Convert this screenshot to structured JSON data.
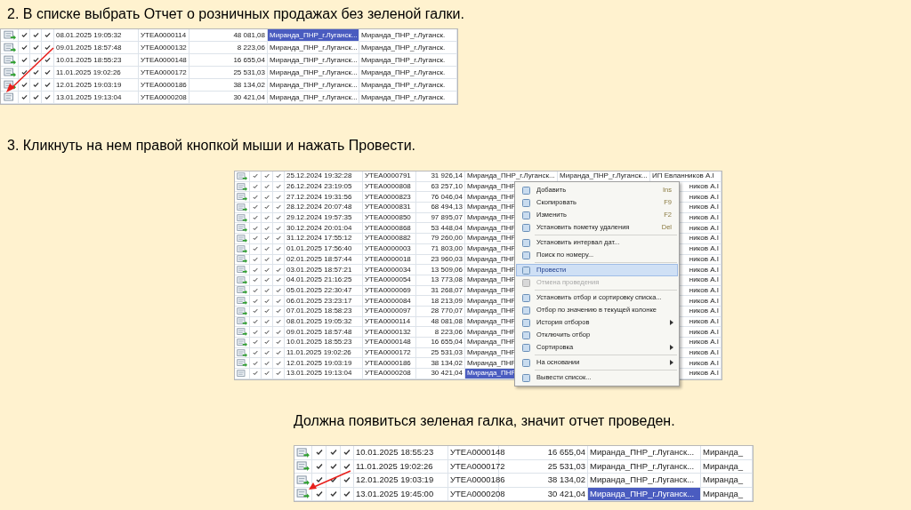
{
  "step_2": {
    "instruction": "2. В списке выбрать Отчет о розничных продажах без зеленой галки.",
    "table": {
      "rows": [
        {
          "posted": true,
          "marks": [
            true,
            true,
            true
          ],
          "date": "08.01.2025 19:05:32",
          "number": "УТЕА0000114",
          "sum": "48 081,08",
          "cells": [
            "Миранда_ПНР_г.Луганск...",
            "Миранда_ПНР_г.Луганск."
          ],
          "selected": true
        },
        {
          "posted": true,
          "marks": [
            true,
            true,
            true
          ],
          "date": "09.01.2025 18:57:48",
          "number": "УТЕА0000132",
          "sum": "8 223,06",
          "cells": [
            "Миранда_ПНР_г.Луганск...",
            "Миранда_ПНР_г.Луганск."
          ],
          "selected": false
        },
        {
          "posted": true,
          "marks": [
            true,
            true,
            true
          ],
          "date": "10.01.2025 18:55:23",
          "number": "УТЕА0000148",
          "sum": "16 655,04",
          "cells": [
            "Миранда_ПНР_г.Луганск...",
            "Миранда_ПНР_г.Луганск."
          ],
          "selected": false
        },
        {
          "posted": true,
          "marks": [
            true,
            true,
            true
          ],
          "date": "11.01.2025 19:02:26",
          "number": "УТЕА0000172",
          "sum": "25 531,03",
          "cells": [
            "Миранда_ПНР_г.Луганск...",
            "Миранда_ПНР_г.Луганск."
          ],
          "selected": false
        },
        {
          "posted": true,
          "marks": [
            true,
            true,
            true
          ],
          "date": "12.01.2025 19:03:19",
          "number": "УТЕА0000186",
          "sum": "38 134,02",
          "cells": [
            "Миранда_ПНР_г.Луганск...",
            "Миранда_ПНР_г.Луганск."
          ],
          "selected": false
        },
        {
          "posted": false,
          "marks": [
            true,
            true,
            true
          ],
          "date": "13.01.2025 19:13:04",
          "number": "УТЕА0000208",
          "sum": "30 421,04",
          "cells": [
            "Миранда_ПНР_г.Луганск...",
            "Миранда_ПНР_г.Луганск."
          ],
          "selected": false
        }
      ]
    }
  },
  "step_3": {
    "instruction": "3. Кликнуть на нем правой кнопкой мыши и нажать Провести.",
    "table": {
      "rows": [
        {
          "posted": true,
          "marks": [
            true,
            true,
            true
          ],
          "date": "25.12.2024 19:32:28",
          "number": "УТЕА0000791",
          "sum": "31 926,14",
          "cells": [
            "Миранда_ПНР_г.Луганск...",
            "Миранда_ПНР_г.Луганск...",
            "ИП Евланников А.I"
          ],
          "selected": false
        },
        {
          "posted": true,
          "marks": [
            true,
            true,
            true
          ],
          "date": "26.12.2024 23:19:05",
          "number": "УТЕА0000808",
          "sum": "63 257,10",
          "cells": [
            "Миранда_ПНР",
            "ников А.I"
          ],
          "selected": false
        },
        {
          "posted": true,
          "marks": [
            true,
            true,
            true
          ],
          "date": "27.12.2024 19:31:56",
          "number": "УТЕА0000823",
          "sum": "76 046,04",
          "cells": [
            "Миранда_ПНР",
            "ников А.I"
          ],
          "selected": false
        },
        {
          "posted": true,
          "marks": [
            true,
            true,
            true
          ],
          "date": "28.12.2024 20:07:48",
          "number": "УТЕА0000831",
          "sum": "68 494,13",
          "cells": [
            "Миранда_ПНР",
            "ников А.I"
          ],
          "selected": false
        },
        {
          "posted": true,
          "marks": [
            true,
            true,
            true
          ],
          "date": "29.12.2024 19:57:35",
          "number": "УТЕА0000850",
          "sum": "97 895,07",
          "cells": [
            "Миранда_ПНР",
            "ников А.I"
          ],
          "selected": false
        },
        {
          "posted": true,
          "marks": [
            true,
            true,
            true
          ],
          "date": "30.12.2024 20:01:04",
          "number": "УТЕА0000868",
          "sum": "53 448,04",
          "cells": [
            "Миранда_ПНР",
            "ников А.I"
          ],
          "selected": false
        },
        {
          "posted": true,
          "marks": [
            true,
            true,
            true
          ],
          "date": "31.12.2024 17:55:12",
          "number": "УТЕА0000882",
          "sum": "79 260,00",
          "cells": [
            "Миранда_ПНР",
            "ников А.I"
          ],
          "selected": false
        },
        {
          "posted": true,
          "marks": [
            true,
            true,
            true
          ],
          "date": "01.01.2025 17:56:40",
          "number": "УТЕА0000003",
          "sum": "71 803,00",
          "cells": [
            "Миранда_ПНР",
            "ников А.I"
          ],
          "selected": false
        },
        {
          "posted": true,
          "marks": [
            true,
            true,
            true
          ],
          "date": "02.01.2025 18:57:44",
          "number": "УТЕА0000018",
          "sum": "23 960,03",
          "cells": [
            "Миранда_ПНР",
            "ников А.I"
          ],
          "selected": false
        },
        {
          "posted": true,
          "marks": [
            true,
            true,
            true
          ],
          "date": "03.01.2025 18:57:21",
          "number": "УТЕА0000034",
          "sum": "13 509,06",
          "cells": [
            "Миранда_ПНР",
            "ников А.I"
          ],
          "selected": false
        },
        {
          "posted": true,
          "marks": [
            true,
            true,
            true
          ],
          "date": "04.01.2025 21:16:25",
          "number": "УТЕА0000054",
          "sum": "13 773,08",
          "cells": [
            "Миранда_ПНР",
            "ников А.I"
          ],
          "selected": false
        },
        {
          "posted": true,
          "marks": [
            true,
            true,
            true
          ],
          "date": "05.01.2025 22:30:47",
          "number": "УТЕА0000069",
          "sum": "31 268,07",
          "cells": [
            "Миранда_ПНР",
            "ников А.I"
          ],
          "selected": false
        },
        {
          "posted": true,
          "marks": [
            true,
            true,
            true
          ],
          "date": "06.01.2025 23:23:17",
          "number": "УТЕА0000084",
          "sum": "18 213,09",
          "cells": [
            "Миранда_ПНР",
            "ников А.I"
          ],
          "selected": false
        },
        {
          "posted": true,
          "marks": [
            true,
            true,
            true
          ],
          "date": "07.01.2025 18:58:23",
          "number": "УТЕА0000097",
          "sum": "28 770,07",
          "cells": [
            "Миранда_ПНР",
            "ников А.I"
          ],
          "selected": false
        },
        {
          "posted": true,
          "marks": [
            true,
            true,
            true
          ],
          "date": "08.01.2025 19:05:32",
          "number": "УТЕА0000114",
          "sum": "48 081,08",
          "cells": [
            "Миранда_ПНР",
            "ников А.I"
          ],
          "selected": false
        },
        {
          "posted": true,
          "marks": [
            true,
            true,
            true
          ],
          "date": "09.01.2025 18:57:48",
          "number": "УТЕА0000132",
          "sum": "8 223,06",
          "cells": [
            "Миранда_ПНР",
            "ников А.I"
          ],
          "selected": false
        },
        {
          "posted": true,
          "marks": [
            true,
            true,
            true
          ],
          "date": "10.01.2025 18:55:23",
          "number": "УТЕА0000148",
          "sum": "16 655,04",
          "cells": [
            "Миранда_ПНР",
            "ников А.I"
          ],
          "selected": false
        },
        {
          "posted": true,
          "marks": [
            true,
            true,
            true
          ],
          "date": "11.01.2025 19:02:26",
          "number": "УТЕА0000172",
          "sum": "25 531,03",
          "cells": [
            "Миранда_ПНР",
            "ников А.I"
          ],
          "selected": false
        },
        {
          "posted": true,
          "marks": [
            true,
            true,
            true
          ],
          "date": "12.01.2025 19:03:19",
          "number": "УТЕА0000186",
          "sum": "38 134,02",
          "cells": [
            "Миранда_ПНР",
            "ников А.I"
          ],
          "selected": false
        },
        {
          "posted": false,
          "marks": [
            true,
            true,
            true
          ],
          "date": "13.01.2025 19:13:04",
          "number": "УТЕА0000208",
          "sum": "30 421,04",
          "cells": [
            "Миранда_ПНР",
            "ников А.I"
          ],
          "selected": true
        }
      ]
    },
    "context_menu": {
      "items": [
        {
          "kind": "item",
          "label": "Добавить",
          "shortcut": "Ins",
          "selected": false,
          "disabled": false
        },
        {
          "kind": "item",
          "label": "Скопировать",
          "shortcut": "F9",
          "selected": false,
          "disabled": false
        },
        {
          "kind": "item",
          "label": "Изменить",
          "shortcut": "F2",
          "selected": false,
          "disabled": false
        },
        {
          "kind": "item",
          "label": "Установить пометку удаления",
          "shortcut": "Del",
          "selected": false,
          "disabled": false
        },
        {
          "kind": "separator"
        },
        {
          "kind": "item",
          "label": "Установить интервал дат...",
          "selected": false,
          "disabled": false
        },
        {
          "kind": "item",
          "label": "Поиск по номеру...",
          "selected": false,
          "disabled": false
        },
        {
          "kind": "separator"
        },
        {
          "kind": "item",
          "label": "Провести",
          "selected": true,
          "disabled": false
        },
        {
          "kind": "item",
          "label": "Отмена проведения",
          "selected": false,
          "disabled": true
        },
        {
          "kind": "separator"
        },
        {
          "kind": "item",
          "label": "Установить отбор и сортировку списка...",
          "selected": false,
          "disabled": false
        },
        {
          "kind": "item",
          "label": "Отбор по значению в текущей колонке",
          "selected": false,
          "disabled": false
        },
        {
          "kind": "item",
          "label": "История отборов",
          "submenu": true,
          "selected": false,
          "disabled": false
        },
        {
          "kind": "item",
          "label": "Отключить отбор",
          "selected": false,
          "disabled": false
        },
        {
          "kind": "item",
          "label": "Сортировка",
          "submenu": true,
          "selected": false,
          "disabled": false
        },
        {
          "kind": "separator"
        },
        {
          "kind": "item",
          "label": "На основании",
          "submenu": true,
          "selected": false,
          "disabled": false
        },
        {
          "kind": "separator"
        },
        {
          "kind": "item",
          "label": "Вывести список...",
          "selected": false,
          "disabled": false
        }
      ]
    }
  },
  "result": {
    "caption": "Должна появиться зеленая галка, значит отчет проведен.",
    "table": {
      "rows": [
        {
          "posted": true,
          "marks": [
            true,
            true,
            true
          ],
          "date": "10.01.2025 18:55:23",
          "number": "УТЕА0000148",
          "sum": "16 655,04",
          "cells": [
            "Миранда_ПНР_г.Луганск...",
            "Миранда_"
          ],
          "selected": false
        },
        {
          "posted": true,
          "marks": [
            true,
            true,
            true
          ],
          "date": "11.01.2025 19:02:26",
          "number": "УТЕА0000172",
          "sum": "25 531,03",
          "cells": [
            "Миранда_ПНР_г.Луганск...",
            "Миранда_"
          ],
          "selected": false
        },
        {
          "posted": true,
          "marks": [
            true,
            true,
            true
          ],
          "date": "12.01.2025 19:03:19",
          "number": "УТЕА0000186",
          "sum": "38 134,02",
          "cells": [
            "Миранда_ПНР_г.Луганск...",
            "Миранда_"
          ],
          "selected": false
        },
        {
          "posted": true,
          "marks": [
            true,
            true,
            true
          ],
          "date": "13.01.2025 19:45:00",
          "number": "УТЕА0000208",
          "sum": "30 421,04",
          "cells": [
            "Миранда_ПНР_г.Луганск...",
            "Миранда_"
          ],
          "selected": true
        }
      ]
    }
  }
}
